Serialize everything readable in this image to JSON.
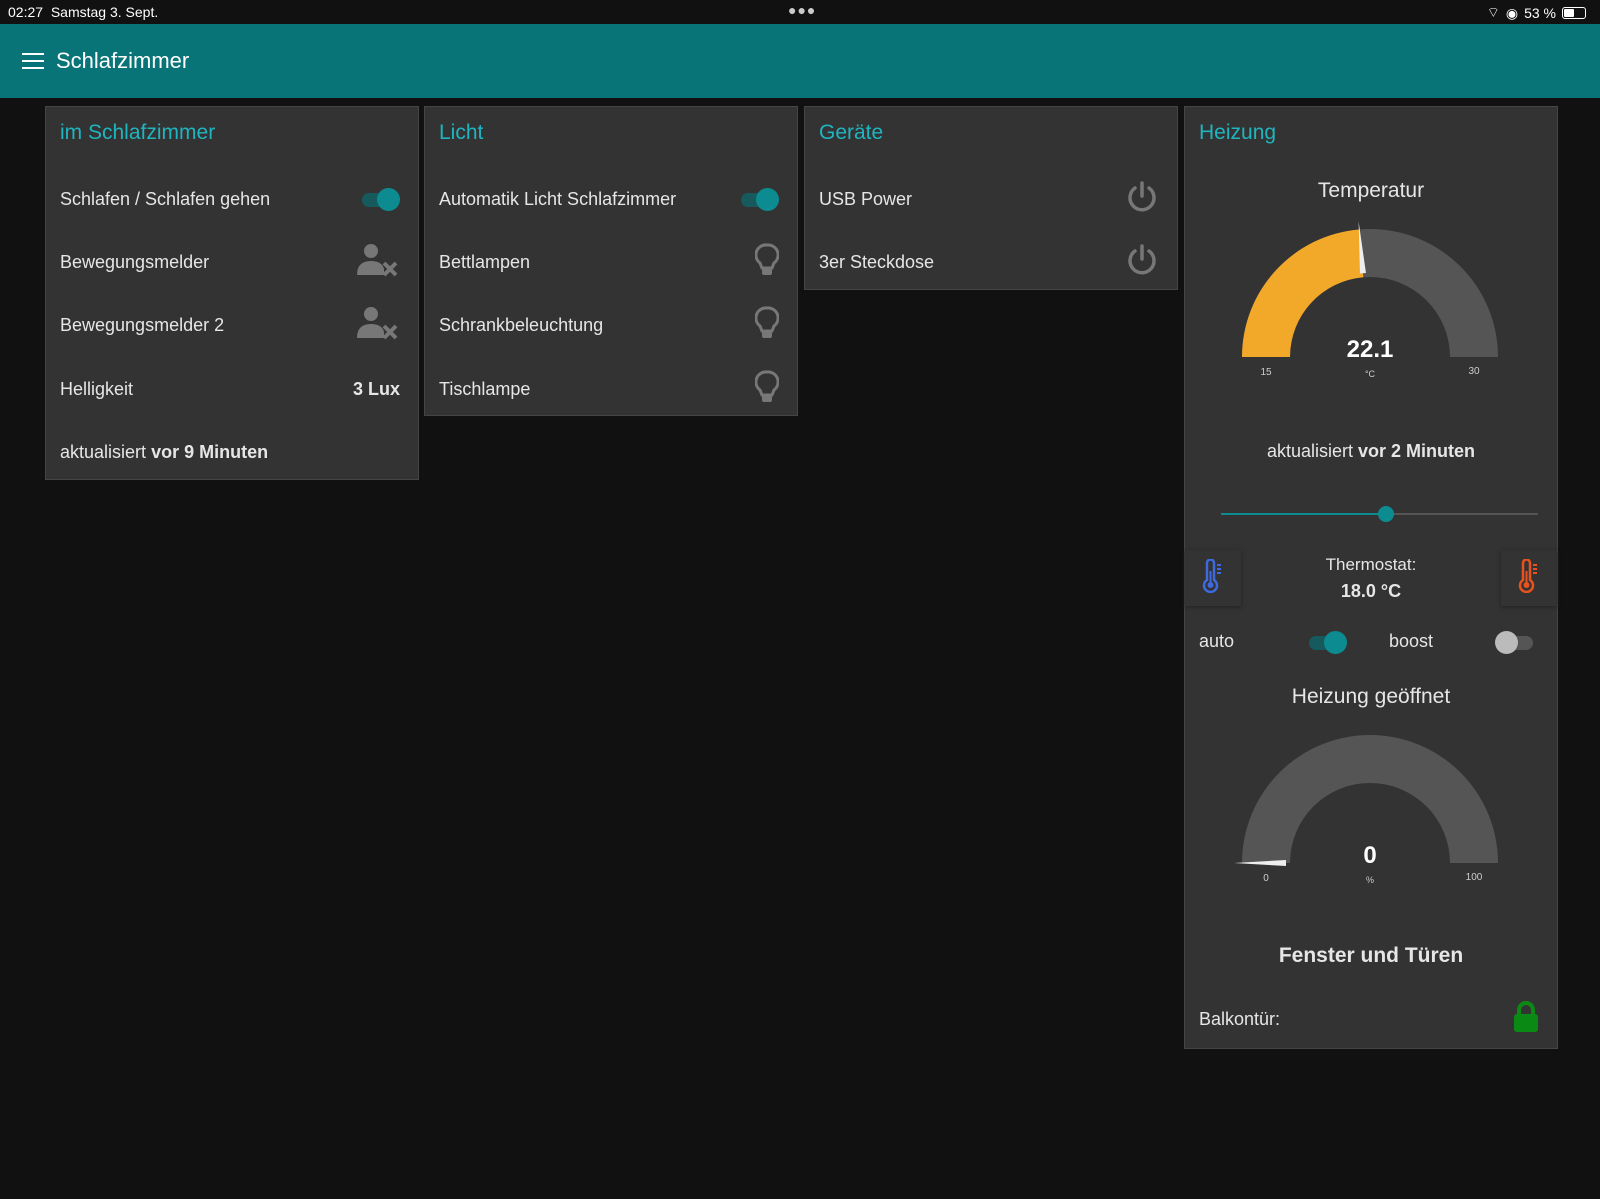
{
  "status_bar": {
    "time": "02:27",
    "date": "Samstag 3. Sept.",
    "battery": "53 %",
    "battery_fraction": 0.53
  },
  "header": {
    "title": "Schlafzimmer"
  },
  "colors": {
    "accent": "#1fb5c0",
    "header": "#087478",
    "gauge_fill": "#f2a829",
    "gauge_track": "#555555",
    "lock": "#0a8a14"
  },
  "cards": {
    "room": {
      "title": "im Schlafzimmer",
      "sleep_label": "Schlafen / Schlafen gehen",
      "sleep_on": true,
      "motion1": "Bewegungsmelder",
      "motion2": "Bewegungsmelder 2",
      "brightness_label": "Helligkeit",
      "brightness_value": "3 Lux",
      "updated_prefix": "aktualisiert",
      "updated_value": "vor 9 Minuten"
    },
    "light": {
      "title": "Licht",
      "auto_label": "Automatik Licht Schlafzimmer",
      "auto_on": true,
      "items": [
        "Bettlampen",
        "Schrankbeleuchtung",
        "Tischlampe"
      ]
    },
    "devices": {
      "title": "Geräte",
      "items": [
        "USB Power",
        "3er Steckdose"
      ]
    },
    "heating": {
      "title": "Heizung",
      "temp_title": "Temperatur",
      "temp_value": "22.1",
      "temp_unit": "°C",
      "temp_min": "15",
      "temp_max": "30",
      "temp": 22.1,
      "updated_prefix": "aktualisiert",
      "updated_value": "vor 2 Minuten",
      "slider_fraction": 0.52,
      "thermostat_label": "Thermostat:",
      "thermostat_value": "18.0 °C",
      "auto_label": "auto",
      "auto_on": true,
      "boost_label": "boost",
      "boost_on": false,
      "valve_title": "Heizung geöffnet",
      "valve_value": "0",
      "valve_unit": "%",
      "valve_min": "0",
      "valve_max": "100",
      "valve": 0,
      "windows_title": "Fenster und Türen",
      "balcony_label": "Balkontür:"
    }
  }
}
